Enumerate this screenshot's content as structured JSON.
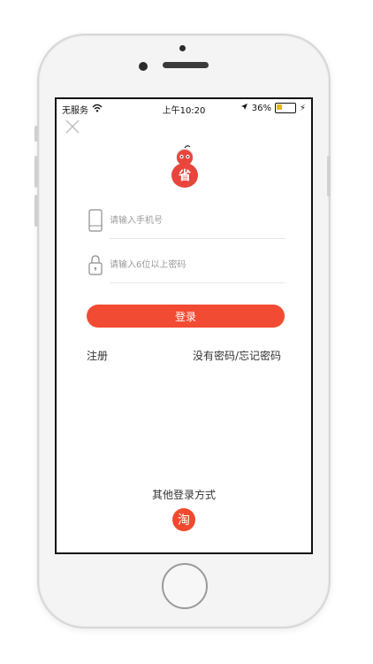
{
  "status_bar": {
    "carrier": "无服务",
    "time": "上午10:20",
    "battery_percent": "36%",
    "battery_level": 0.36
  },
  "login": {
    "phone_placeholder": "请输入手机号",
    "password_placeholder": "请输入6位以上密码",
    "login_button": "登录",
    "register_link": "注册",
    "forgot_link": "没有密码/忘记密码",
    "other_methods": "其他登录方式",
    "taobao_glyph": "淘"
  },
  "icons": {
    "close": "close-icon",
    "wifi": "wifi-icon",
    "location": "location-arrow-icon",
    "battery": "battery-icon",
    "charging": "charging-bolt-icon",
    "phone": "mobile-phone-icon",
    "lock": "lock-icon",
    "app_logo": "app-logo"
  },
  "colors": {
    "accent": "#f24b33",
    "battery_fill": "#e6b800"
  }
}
